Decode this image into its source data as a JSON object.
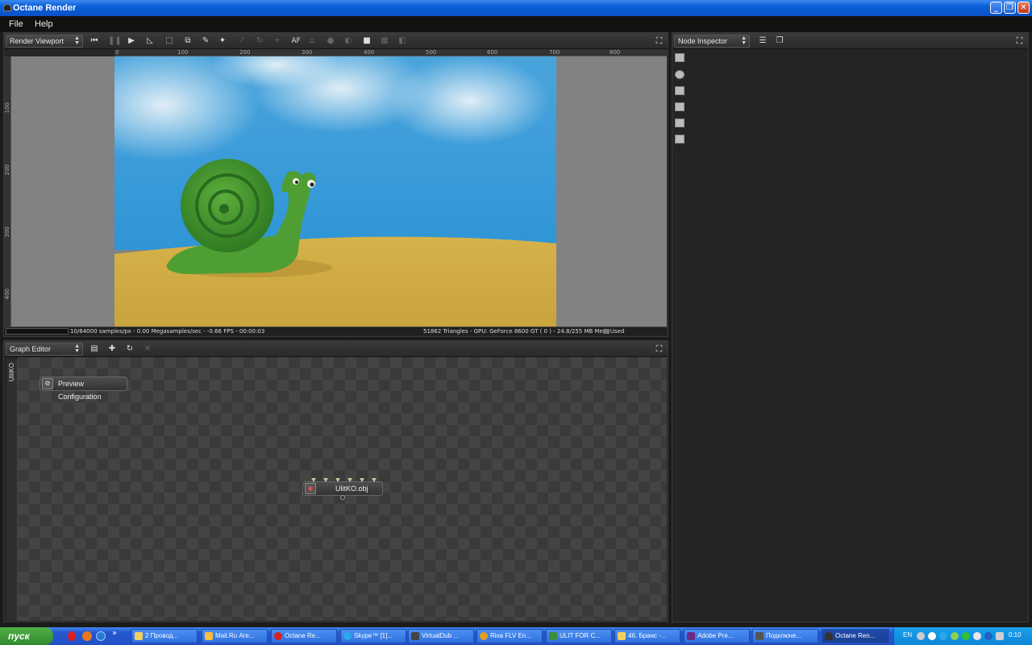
{
  "window": {
    "title": "Octane Render",
    "min_label": "_",
    "max_label": "❐",
    "close_label": "✕"
  },
  "menu": {
    "items": [
      "File",
      "Help"
    ]
  },
  "render_viewport": {
    "selector_label": "Render Viewport",
    "af_label": "AF",
    "ruler_top_ticks": [
      "0",
      "100",
      "200",
      "300",
      "400",
      "500",
      "600",
      "700",
      "800"
    ],
    "ruler_left_ticks": [
      "100",
      "200",
      "300",
      "400"
    ],
    "status_left": "10/64000 samples/px - 0.00 Megasamples/sec - -0.66 FPS - 00:00:03",
    "status_right": "51862 Triangles - GPU: GeForce 8600 GT ( 0 ) - 24.8/255 MB Mem Used"
  },
  "node_inspector": {
    "selector_label": "Node Inspector"
  },
  "graph_editor": {
    "selector_label": "Graph Editor",
    "side_tab": "UlitKO",
    "nodes": {
      "preview": "Preview Configuration",
      "mesh": "UlitKO.obj"
    }
  },
  "taskbar": {
    "start_label": "пуск",
    "tasks": [
      "2 Провод...",
      "Mail.Ru Аге...",
      "Octane Re...",
      "Skype™ [1]...",
      "VirtualDub ...",
      "Riva FLV En...",
      "ULIT FOR C...",
      "46. Бранс -...",
      "Adobe Pre...",
      "Подключе...",
      "Octane Ren..."
    ],
    "lang": "EN",
    "clock": "0:10"
  },
  "colors": {
    "titlebar": "#0a5fd8",
    "sky": "#3ea0d8",
    "sand": "#d8b448",
    "snail": "#4a9a30"
  }
}
